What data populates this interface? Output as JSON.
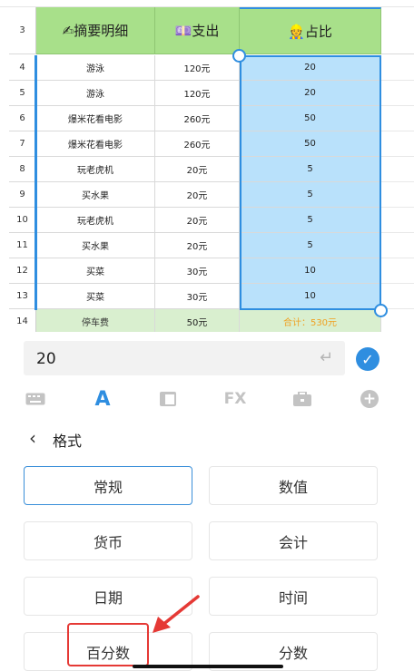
{
  "sheet": {
    "header": {
      "row_number": "3",
      "col_a": "✍摘要明细",
      "col_b": "💷支出",
      "col_c": "👷占比"
    },
    "rows": [
      {
        "num": "4",
        "desc": "游泳",
        "expense": "120元",
        "ratio": "20"
      },
      {
        "num": "5",
        "desc": "游泳",
        "expense": "120元",
        "ratio": "20"
      },
      {
        "num": "6",
        "desc": "爆米花看电影",
        "expense": "260元",
        "ratio": "50"
      },
      {
        "num": "7",
        "desc": "爆米花看电影",
        "expense": "260元",
        "ratio": "50"
      },
      {
        "num": "8",
        "desc": "玩老虎机",
        "expense": "20元",
        "ratio": "5"
      },
      {
        "num": "9",
        "desc": "买水果",
        "expense": "20元",
        "ratio": "5"
      },
      {
        "num": "10",
        "desc": "玩老虎机",
        "expense": "20元",
        "ratio": "5"
      },
      {
        "num": "11",
        "desc": "买水果",
        "expense": "20元",
        "ratio": "5"
      },
      {
        "num": "12",
        "desc": "买菜",
        "expense": "30元",
        "ratio": "10"
      },
      {
        "num": "13",
        "desc": "买菜",
        "expense": "30元",
        "ratio": "10"
      }
    ],
    "total_row": {
      "num": "14",
      "desc": "停车费",
      "expense": "50元",
      "ratio": "合计：530元"
    },
    "colors": {
      "header_green": "#a8e08a",
      "selection_blue": "#b9e1fb",
      "accent": "#2f8ee0"
    }
  },
  "formula_bar": {
    "value": "20",
    "enter_icon": "return-icon",
    "confirm_icon": "check-icon"
  },
  "toolbar": {
    "items": [
      {
        "name": "keyboard-icon",
        "glyph": "⌨"
      },
      {
        "name": "font-format-icon",
        "glyph": "A"
      },
      {
        "name": "layout-icon",
        "glyph": "▤"
      },
      {
        "name": "function-icon",
        "glyph": "FX"
      },
      {
        "name": "toolbox-icon",
        "glyph": "💼"
      },
      {
        "name": "insert-icon",
        "glyph": "+"
      }
    ]
  },
  "format_panel": {
    "back_glyph": "‹",
    "title": "格式",
    "options": [
      "常规",
      "数值",
      "货币",
      "会计",
      "日期",
      "时间",
      "百分数",
      "分数"
    ],
    "selected": "常规",
    "highlighted": "百分数"
  }
}
